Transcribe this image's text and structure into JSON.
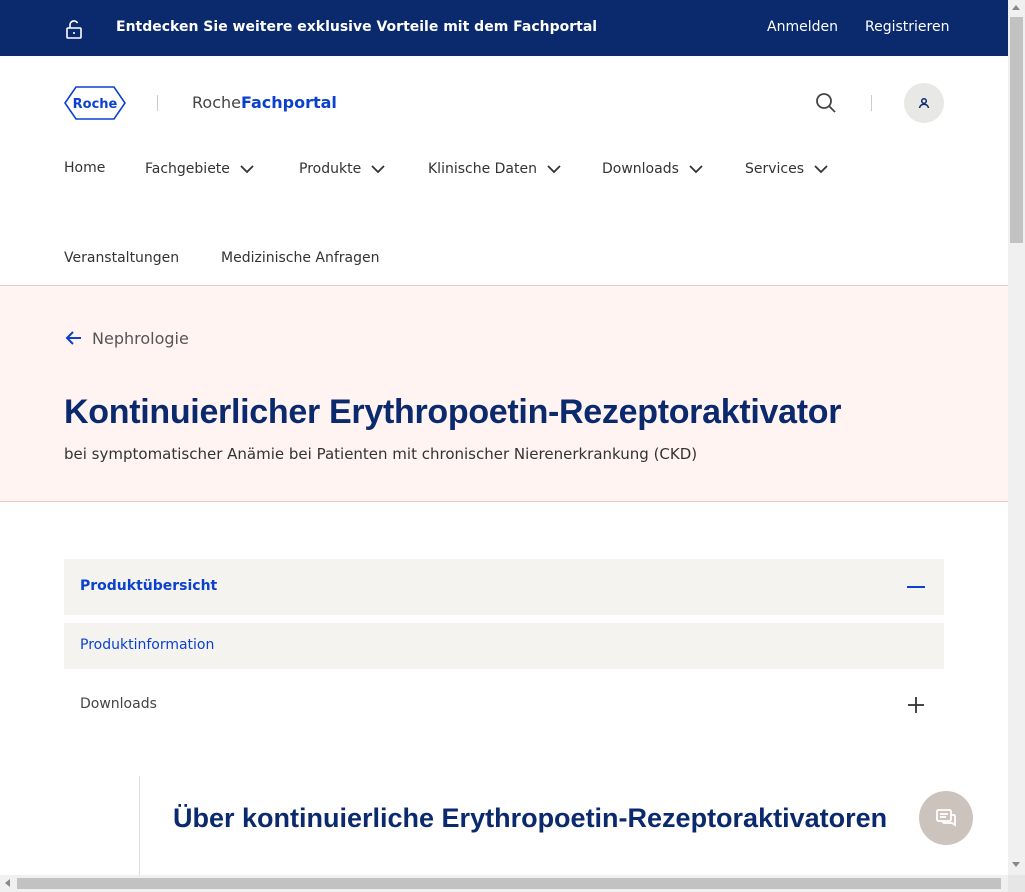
{
  "topbar": {
    "promo": "Entdecken Sie weitere exklusive Vorteile mit dem Fachportal",
    "login": "Anmelden",
    "register": "Registrieren",
    "lock_icon": "unlock-icon"
  },
  "header": {
    "logo_text": "Roche",
    "portal_prefix": "Roche",
    "portal_suffix": "Fachportal",
    "search_icon": "search-icon",
    "user_icon": "user-icon"
  },
  "nav": {
    "items": [
      {
        "label": "Home"
      },
      {
        "label": "Fachgebiete"
      },
      {
        "label": "Produkte"
      },
      {
        "label": "Klinische Daten"
      },
      {
        "label": "Downloads"
      },
      {
        "label": "Services"
      },
      {
        "label": "Veranstaltungen"
      },
      {
        "label": "Medizinische Anfragen"
      }
    ]
  },
  "hero": {
    "back_label": "Nephrologie",
    "title": "Kontinuierlicher Erythropoetin-Rezeptoraktivator",
    "subtitle": "bei symptomatischer Anämie bei Patienten mit chronischer Nierenerkrankung (CKD)"
  },
  "accordion": {
    "items": [
      {
        "label": "Produktübersicht",
        "state": "expanded"
      },
      {
        "label": "Produktinformation",
        "state": "sub-item"
      },
      {
        "label": "Downloads",
        "state": "collapsed"
      }
    ]
  },
  "section": {
    "title": "Über kontinuierliche Erythropoetin-Rezeptoraktivatoren"
  },
  "colors": {
    "topbar_bg": "#0b2a6e",
    "brand_blue": "#0b41cd",
    "hero_bg": "#fff4f2",
    "accordion_bg": "#f4f3f0",
    "chat_bg": "#cdc3bd"
  }
}
